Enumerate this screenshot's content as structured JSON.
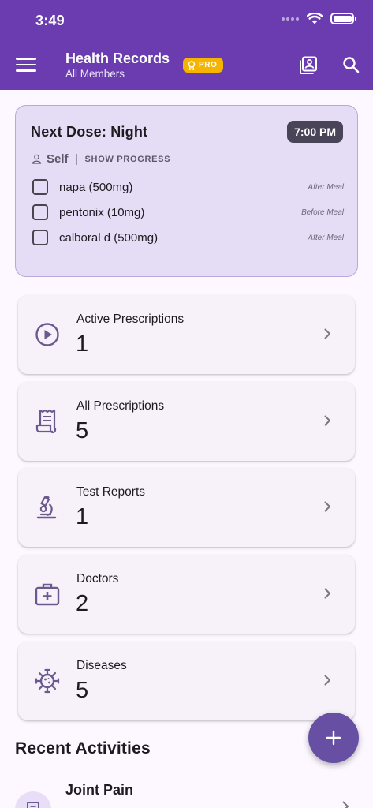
{
  "status_bar": {
    "time": "3:49"
  },
  "app_bar": {
    "title": "Health Records",
    "subtitle": "All Members",
    "badge": "PRO",
    "icons": {
      "menu": "menu-icon",
      "members": "member-records-icon",
      "search": "search-icon"
    }
  },
  "next_dose": {
    "title": "Next Dose: Night",
    "time": "7:00 PM",
    "member": "Self",
    "show_progress_label": "SHOW PROGRESS",
    "medicines": [
      {
        "name": "napa (500mg)",
        "note": "After Meal"
      },
      {
        "name": "pentonix (10mg)",
        "note": "Before Meal"
      },
      {
        "name": "calboral d (500mg)",
        "note": "After Meal"
      }
    ]
  },
  "stats": [
    {
      "label": "Active Prescriptions",
      "value": "1",
      "icon": "play-circle-icon"
    },
    {
      "label": "All Prescriptions",
      "value": "5",
      "icon": "prescription-receipt-icon"
    },
    {
      "label": "Test Reports",
      "value": "1",
      "icon": "microscope-icon"
    },
    {
      "label": "Doctors",
      "value": "2",
      "icon": "medical-bag-icon"
    },
    {
      "label": "Diseases",
      "value": "5",
      "icon": "virus-icon"
    }
  ],
  "recent": {
    "title": "Recent Activities",
    "items": [
      {
        "name": "Joint Pain"
      }
    ]
  },
  "colors": {
    "primary": "#6a3cb0",
    "pro_badge": "#f4b400",
    "card_bg": "#e5dcf5",
    "fab": "#6750a4"
  }
}
